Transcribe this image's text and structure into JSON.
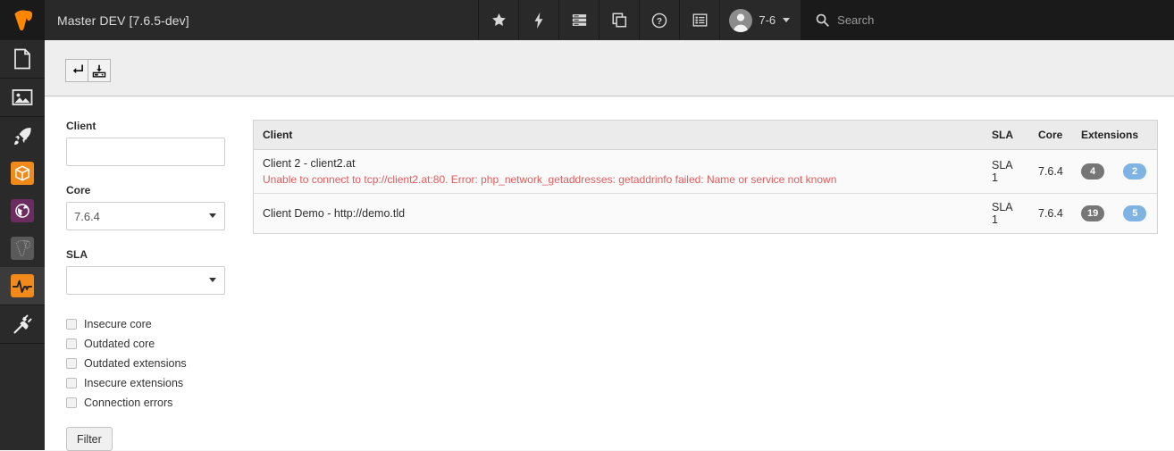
{
  "topbar": {
    "logo_icon": "typo3-logo-icon",
    "site_title": "Master DEV [7.6.5-dev]",
    "buttons": [
      {
        "name": "bookmarks-button",
        "icon": "star-icon"
      },
      {
        "name": "flash-messages-button",
        "icon": "bolt-icon"
      },
      {
        "name": "system-information-button",
        "icon": "server-icon"
      },
      {
        "name": "clipboard-button",
        "icon": "copy-icon"
      },
      {
        "name": "help-button",
        "icon": "question-circle-icon"
      },
      {
        "name": "workspaces-button",
        "icon": "list-alt-icon"
      }
    ],
    "user": {
      "label": "7-6",
      "avatar_icon": "user-avatar-icon",
      "caret_icon": "caret-down-icon"
    },
    "search": {
      "label": "Search",
      "placeholder": "Search",
      "icon": "search-icon"
    }
  },
  "modulemenu": {
    "groups": [
      {
        "items": [
          {
            "name": "sidebar-item-page",
            "icon": "page-icon",
            "tile": "none",
            "active": false
          }
        ]
      },
      {
        "items": [
          {
            "name": "sidebar-item-filelist",
            "icon": "image-icon",
            "tile": "none",
            "active": false
          }
        ]
      },
      {
        "items": [
          {
            "name": "sidebar-item-upgrade",
            "icon": "rocket-icon",
            "tile": "none",
            "active": false
          },
          {
            "name": "sidebar-item-extensions",
            "icon": "package-box-icon",
            "tile": "#f18a1b",
            "active": false
          },
          {
            "name": "sidebar-item-languages",
            "icon": "globe-icon",
            "tile": "#6b2c5f",
            "active": false
          },
          {
            "name": "sidebar-item-typo3-module",
            "icon": "typo3-outline-icon",
            "tile": "#5a5a5a",
            "active": false
          },
          {
            "name": "sidebar-item-monitoring",
            "icon": "pulse-icon",
            "tile": "#f18a1b",
            "active": true
          }
        ]
      },
      {
        "items": [
          {
            "name": "sidebar-item-plugins",
            "icon": "plug-icon",
            "tile": "none",
            "active": false
          }
        ]
      }
    ]
  },
  "docheader": {
    "buttons": [
      {
        "name": "back-button",
        "icon": "return-arrow-icon",
        "label": "↵"
      },
      {
        "name": "save-button",
        "icon": "save-download-icon",
        "label": ""
      }
    ]
  },
  "filter": {
    "client": {
      "label": "Client",
      "value": "",
      "placeholder": ""
    },
    "core": {
      "label": "Core",
      "value": "7.6.4",
      "options": [
        "7.6.4"
      ]
    },
    "sla": {
      "label": "SLA",
      "value": "",
      "options": [
        ""
      ]
    },
    "checkboxes": [
      {
        "label": "Insecure core",
        "checked": false
      },
      {
        "label": "Outdated core",
        "checked": false
      },
      {
        "label": "Outdated extensions",
        "checked": false
      },
      {
        "label": "Insecure extensions",
        "checked": false
      },
      {
        "label": "Connection errors",
        "checked": false
      }
    ],
    "submit_label": "Filter"
  },
  "table": {
    "headers": {
      "client": "Client",
      "sla": "SLA",
      "core": "Core",
      "extensions": "Extensions"
    },
    "rows": [
      {
        "client": "Client 2 - client2.at",
        "error": "Unable to connect to tcp://client2.at:80. Error: php_network_getaddresses: getaddrinfo failed: Name or service not known",
        "sla": "SLA 1",
        "core": "7.6.4",
        "ext_total": "4",
        "ext_updates": "2"
      },
      {
        "client": "Client Demo - http://demo.tld",
        "error": "",
        "sla": "SLA 1",
        "core": "7.6.4",
        "ext_total": "19",
        "ext_updates": "5"
      }
    ]
  },
  "colors": {
    "topbar_bg": "#1a1a1a",
    "topbar_panel": "#292929",
    "sidebar_bg": "#2a2a2a",
    "accent_orange": "#f18a1b",
    "accent_purple": "#6b2c5f",
    "core_cell_green": "#d9e5c4",
    "badge_gray": "#767676",
    "badge_blue": "#7eb3e3",
    "error_red": "#e05c5c"
  }
}
